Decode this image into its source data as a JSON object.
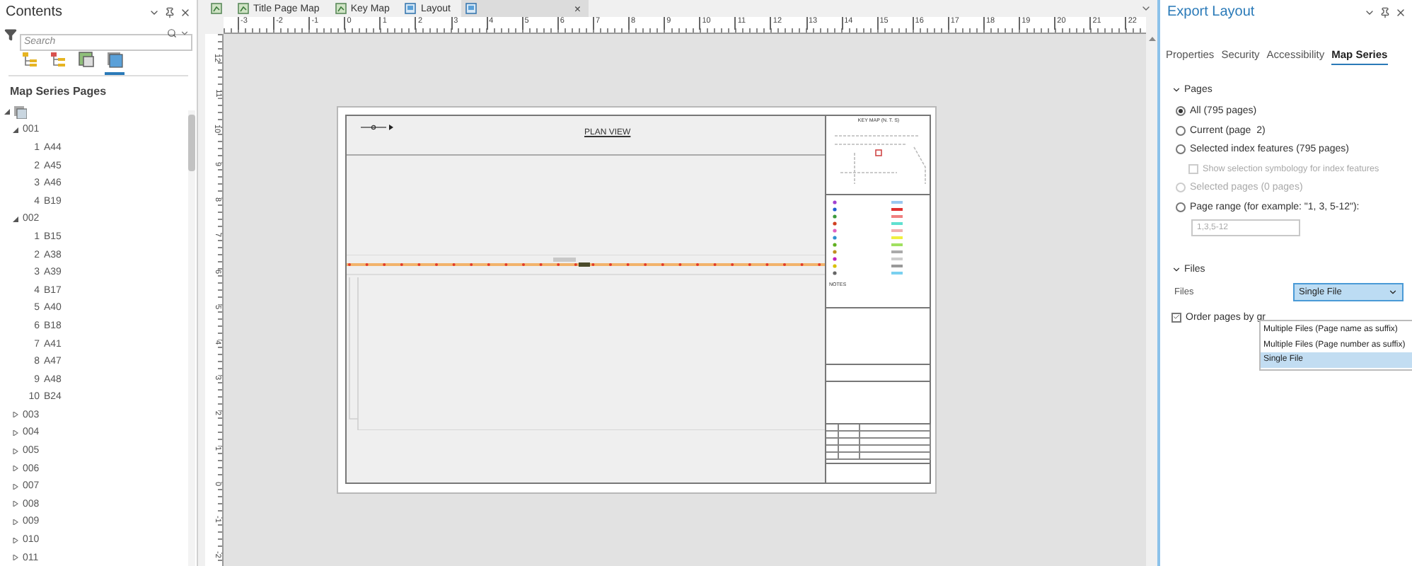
{
  "contents_pane": {
    "title": "Contents",
    "search": {
      "placeholder": "Search"
    },
    "toolbar": [
      {
        "kind": "drawing-order",
        "selected": false
      },
      {
        "kind": "source",
        "selected": false
      },
      {
        "kind": "selection",
        "selected": false
      },
      {
        "kind": "map-series",
        "selected": true
      }
    ],
    "section_title": "Map Series Pages",
    "tree": [
      {
        "expanded": true,
        "children": [
          {
            "label": "001",
            "expanded": true,
            "children": [
              {
                "number": "1",
                "label": "A44"
              },
              {
                "number": "2",
                "label": "A45"
              },
              {
                "number": "3",
                "label": "A46"
              },
              {
                "number": "4",
                "label": "B19"
              }
            ]
          },
          {
            "label": "002",
            "expanded": true,
            "children": [
              {
                "number": "1",
                "label": "B15"
              },
              {
                "number": "2",
                "label": "A38"
              },
              {
                "number": "3",
                "label": "A39"
              },
              {
                "number": "4",
                "label": "B17"
              },
              {
                "number": "5",
                "label": "A40"
              },
              {
                "number": "6",
                "label": "B18"
              },
              {
                "number": "7",
                "label": "A41"
              },
              {
                "number": "8",
                "label": "A47"
              },
              {
                "number": "9",
                "label": "A48"
              },
              {
                "number": "10",
                "label": "B24"
              }
            ]
          },
          {
            "label": "003",
            "expanded": false
          },
          {
            "label": "004",
            "expanded": false
          },
          {
            "label": "005",
            "expanded": false
          },
          {
            "label": "006",
            "expanded": false
          },
          {
            "label": "007",
            "expanded": false
          },
          {
            "label": "008",
            "expanded": false
          },
          {
            "label": "009",
            "expanded": false
          },
          {
            "label": "010",
            "expanded": false
          },
          {
            "label": "011",
            "expanded": false
          }
        ]
      }
    ]
  },
  "view_tabs": [
    {
      "kind": "map",
      "selected": false
    },
    {
      "kind": "map",
      "label": "Title Page Map",
      "selected": false
    },
    {
      "kind": "map",
      "label": "Key Map",
      "selected": false
    },
    {
      "kind": "layout",
      "label": "Layout",
      "selected": false
    },
    {
      "kind": "layout",
      "selected": true,
      "close": "×"
    }
  ],
  "ruler": {
    "horizontal": [
      "-3",
      "-2",
      "-1",
      "0",
      "1",
      "2",
      "3",
      "4",
      "5",
      "6",
      "7",
      "8",
      "9",
      "10",
      "11",
      "12",
      "13",
      "14",
      "15",
      "16",
      "17",
      "18",
      "19",
      "20",
      "21",
      "22"
    ],
    "vertical": [
      "12",
      "11",
      "10",
      "9",
      "8",
      "7",
      "6",
      "5",
      "4",
      "3",
      "2",
      "1",
      "0",
      "-1",
      "-2"
    ]
  },
  "layout_page": {
    "title": "PLAN VIEW",
    "key_map_title": "KEY MAP (N. T. S)",
    "notes_label": "NOTES"
  },
  "export_pane": {
    "title": "Export Layout",
    "tabs": [
      {
        "label": "Properties",
        "selected": false
      },
      {
        "label": "Security",
        "selected": false
      },
      {
        "label": "Accessibility",
        "selected": false
      },
      {
        "label": "Map Series",
        "selected": true
      }
    ],
    "pages": {
      "title": "Pages",
      "expanded": true,
      "options": [
        {
          "kind": "radio",
          "label": "All (795 pages)",
          "selected": true,
          "disabled": false
        },
        {
          "kind": "radio",
          "label": "Current (page  2)",
          "selected": false,
          "disabled": false
        },
        {
          "kind": "radio",
          "label": "Selected index features (795 pages)",
          "selected": false,
          "disabled": false
        },
        {
          "kind": "checkbox",
          "label": "Show selection symbology for index features",
          "checked": false,
          "disabled": true
        },
        {
          "kind": "radio",
          "label": "Selected pages (0 pages)",
          "selected": false,
          "disabled": true
        },
        {
          "kind": "radio",
          "label": "Page range (for example: \"1, 3, 5-12\"):",
          "selected": false,
          "disabled": false
        }
      ],
      "page_range": {
        "placeholder": "1,3,5-12"
      }
    },
    "files": {
      "title": "Files",
      "expanded": true,
      "label": "Files",
      "dropdown": {
        "value": "Single File",
        "open": true,
        "options": [
          {
            "label": "Multiple Files (Page name as suffix)",
            "selected": false
          },
          {
            "label": "Multiple Files (Page number as suffix)",
            "selected": false
          },
          {
            "label": "Single File",
            "selected": true
          }
        ]
      },
      "order_checkbox": {
        "label": "Order pages by gr",
        "checked": true
      }
    }
  }
}
